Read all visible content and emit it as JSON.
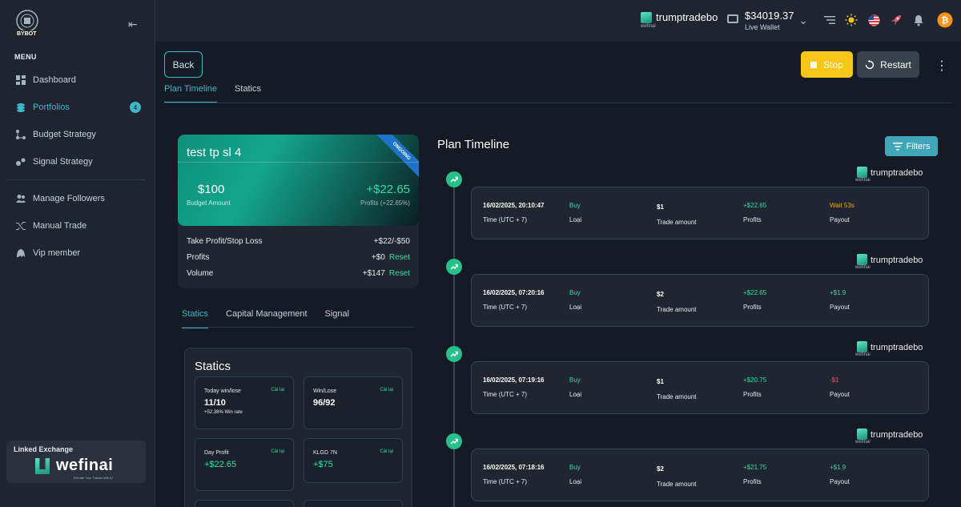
{
  "app": {
    "logo_text": "BYBOT"
  },
  "sidebar": {
    "menu_title": "MENU",
    "items": [
      {
        "label": "Dashboard",
        "icon": "dashboard-icon"
      },
      {
        "label": "Portfolios",
        "icon": "portfolio-icon",
        "badge": "4",
        "active": true
      },
      {
        "label": "Budget Strategy",
        "icon": "budget-icon"
      },
      {
        "label": "Signal Strategy",
        "icon": "signal-icon"
      },
      {
        "label": "Manage Followers",
        "icon": "followers-icon"
      },
      {
        "label": "Manual Trade",
        "icon": "trade-icon"
      },
      {
        "label": "Vip member",
        "icon": "vip-icon"
      }
    ],
    "linked": {
      "label": "Linked Exchange",
      "brand": "wefinai",
      "tagline": "Elevate Your Trades with AI"
    }
  },
  "header": {
    "brand_sub": "wefinai",
    "username": "trumptradebo",
    "wallet_amount": "$34019.37",
    "wallet_label": "Live Wallet"
  },
  "toolbar": {
    "back": "Back",
    "stop": "Stop",
    "restart": "Restart"
  },
  "tabs": [
    "Plan Timeline",
    "Statics"
  ],
  "plan": {
    "name": "test tp sl 4",
    "ribbon": "ONGOING",
    "budget": "$100",
    "budget_label": "Budget Amount",
    "profit": "+$22.65",
    "profit_label": "Profits (+22.65%)",
    "rows": [
      {
        "label": "Take Profit/Stop Loss",
        "value": "+$22/-$50",
        "reset": ""
      },
      {
        "label": "Profits",
        "value": "+$0",
        "reset": "Reset"
      },
      {
        "label": "Volume",
        "value": "+$147",
        "reset": "Reset"
      }
    ]
  },
  "subtabs": [
    "Statics",
    "Capital Management",
    "Signal"
  ],
  "statics": {
    "title": "Statics",
    "cards": [
      {
        "title": "Today win/lose",
        "reset": "Cài lại",
        "value": "11/10",
        "sub": "+52.38% Win rate"
      },
      {
        "title": "Win/Lose",
        "reset": "Cài lại",
        "value": "96/92",
        "sub": ""
      },
      {
        "title": "Day Profit",
        "reset": "Cài lại",
        "value": "+$22.65",
        "sub": ""
      },
      {
        "title": "KLGD 7N",
        "reset": "Cài lại",
        "value": "+$75",
        "sub": ""
      }
    ]
  },
  "timeline": {
    "title": "Plan Timeline",
    "filters": "Filters",
    "labels": {
      "time": "Time (UTC + 7)",
      "type": "Loại",
      "amount": "Trade amount",
      "profits": "Profits",
      "payout": "Payout"
    },
    "items": [
      {
        "user": "trumptradebo",
        "datetime": "16/02/2025, 20:10:47",
        "type": "Buy",
        "amount": "$1",
        "profit": "+$22.65",
        "payout": "Wait 53s",
        "payout_color": "#f5a623"
      },
      {
        "user": "trumptradebo",
        "datetime": "16/02/2025, 07:20:16",
        "type": "Buy",
        "amount": "$2",
        "profit": "+$22.65",
        "payout": "+$1.9",
        "payout_color": "#38d9a9"
      },
      {
        "user": "trumptradebo",
        "datetime": "16/02/2025, 07:19:16",
        "type": "Buy",
        "amount": "$1",
        "profit": "+$20.75",
        "payout": "-$1",
        "payout_color": "#f0506e"
      },
      {
        "user": "trumptradebo",
        "datetime": "16/02/2025, 07:18:16",
        "type": "Buy",
        "amount": "$2",
        "profit": "+$21.75",
        "payout": "+$1.9",
        "payout_color": "#38d9a9"
      }
    ]
  }
}
